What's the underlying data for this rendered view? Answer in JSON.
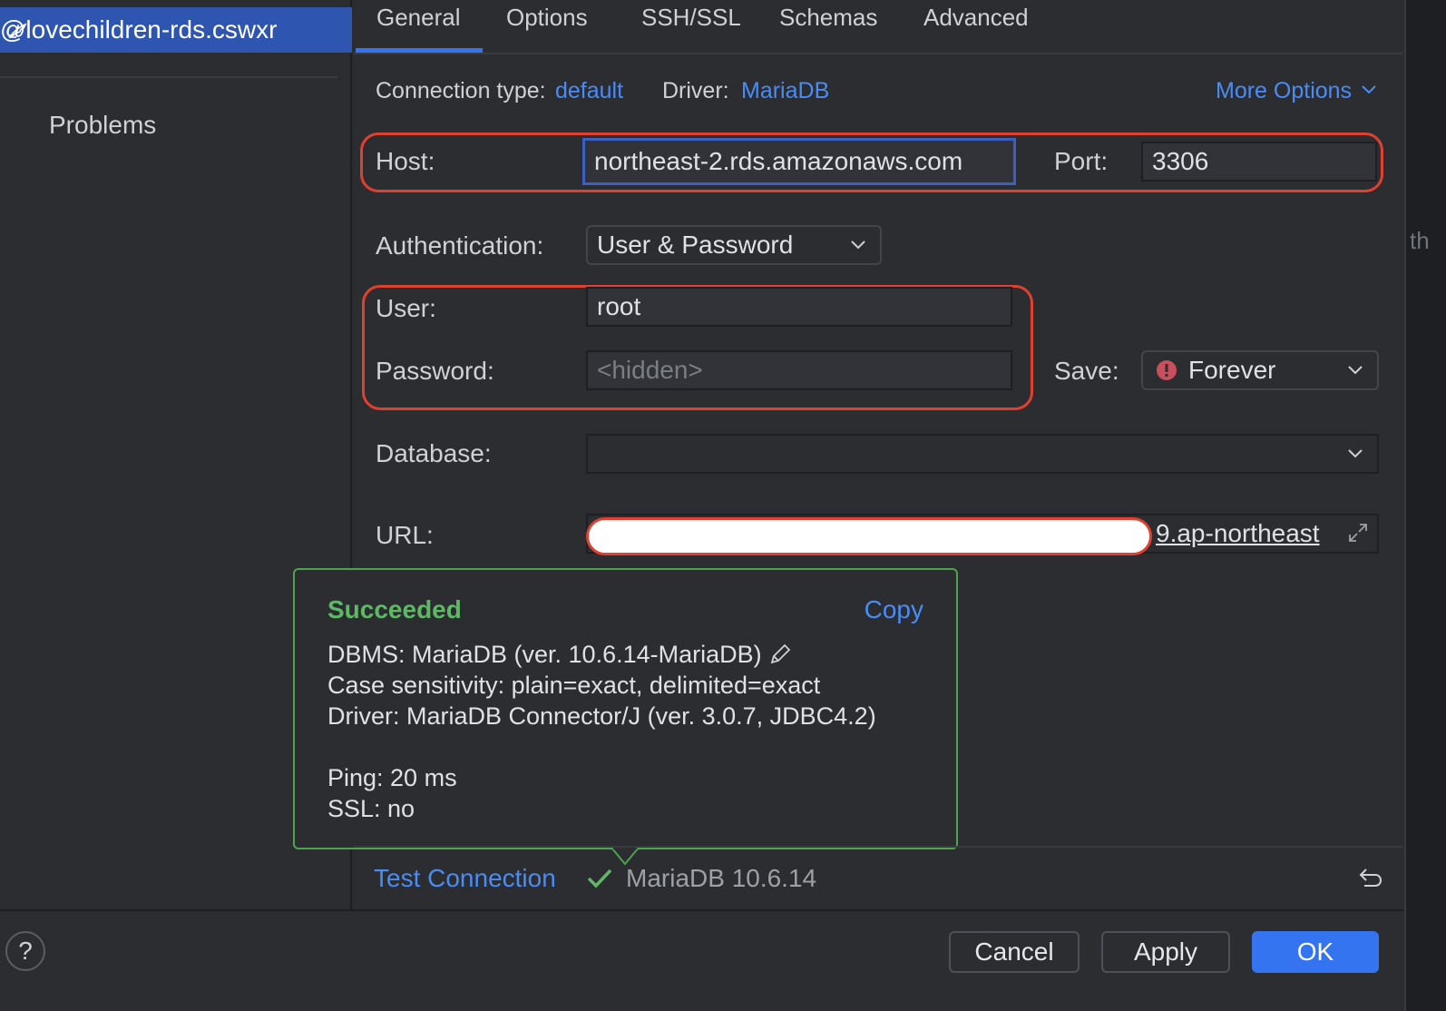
{
  "connection": {
    "name": "@lovechildren-rds.cswxr"
  },
  "sidebar": {
    "problems_label": "Problems"
  },
  "right_fragment": "th",
  "tabs": [
    "General",
    "Options",
    "SSH/SSL",
    "Schemas",
    "Advanced"
  ],
  "active_tab": "General",
  "header": {
    "connection_type_label": "Connection type:",
    "connection_type_value": "default",
    "driver_label": "Driver:",
    "driver_value": "MariaDB",
    "more_options": "More Options"
  },
  "form": {
    "host_label": "Host:",
    "host_value": "northeast-2.rds.amazonaws.com",
    "port_label": "Port:",
    "port_value": "3306",
    "auth_label": "Authentication:",
    "auth_value": "User & Password",
    "user_label": "User:",
    "user_value": "root",
    "password_label": "Password:",
    "password_placeholder": "<hidden>",
    "save_label": "Save:",
    "save_value": "Forever",
    "database_label": "Database:",
    "database_value": "",
    "url_label": "URL:",
    "url_visible_tail": "9.ap-northeast"
  },
  "popup": {
    "title": "Succeeded",
    "copy": "Copy",
    "dbms": "DBMS: MariaDB (ver. 10.6.14-MariaDB)",
    "case_sensitivity": "Case sensitivity: plain=exact, delimited=exact",
    "driver": "Driver: MariaDB Connector/J (ver. 3.0.7, JDBC4.2)",
    "ping": "Ping: 20 ms",
    "ssl": "SSL: no"
  },
  "status": {
    "test_connection": "Test Connection",
    "result": "MariaDB 10.6.14"
  },
  "footer": {
    "help": "?",
    "cancel": "Cancel",
    "apply": "Apply",
    "ok": "OK"
  },
  "colors": {
    "accent": "#3574f0",
    "link": "#4a8cf7",
    "success": "#5fb865",
    "highlight_red": "#e0402f",
    "background": "#2b2d30"
  }
}
